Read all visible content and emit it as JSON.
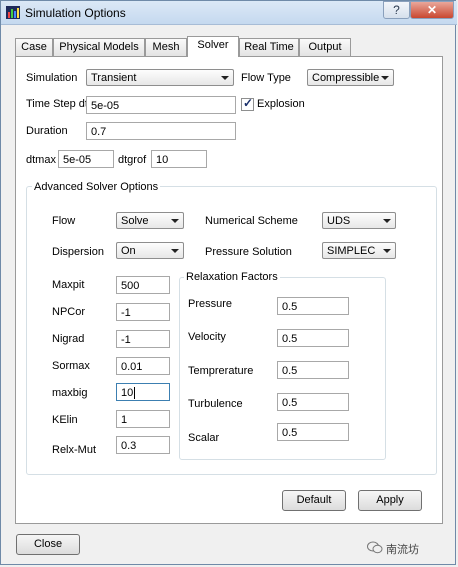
{
  "window": {
    "title": "Simulation Options",
    "help": "?",
    "close": "✕"
  },
  "tabs": [
    {
      "label": "Case",
      "active": false
    },
    {
      "label": "Physical Models",
      "active": false
    },
    {
      "label": "Mesh",
      "active": false
    },
    {
      "label": "Solver",
      "active": true
    },
    {
      "label": "Real Time",
      "active": false
    },
    {
      "label": "Output",
      "active": false
    }
  ],
  "solver": {
    "simulation_label": "Simulation",
    "simulation_value": "Transient",
    "flow_type_label": "Flow Type",
    "flow_type_value": "Compressible",
    "time_step_label": "Time Step dt",
    "time_step_value": "5e-05",
    "explosion_label": "Explosion",
    "explosion_checked": true,
    "duration_label": "Duration",
    "duration_value": "0.7",
    "dtmax_label": "dtmax",
    "dtmax_value": "5e-05",
    "dtgrof_label": "dtgrof",
    "dtgrof_value": "10"
  },
  "advanced": {
    "title": "Advanced Solver Options",
    "flow_label": "Flow",
    "flow_value": "Solve",
    "dispersion_label": "Dispersion",
    "dispersion_value": "On",
    "scheme_label": "Numerical Scheme",
    "scheme_value": "UDS",
    "pressure_solution_label": "Pressure Solution",
    "pressure_solution_value": "SIMPLEC",
    "maxpit_label": "Maxpit",
    "maxpit_value": "500",
    "npcor_label": "NPCor",
    "npcor_value": "-1",
    "nigrad_label": "Nigrad",
    "nigrad_value": "-1",
    "sormax_label": "Sormax",
    "sormax_value": "0.01",
    "maxbig_label": "maxbig",
    "maxbig_value": "10",
    "kelin_label": "KElin",
    "kelin_value": "1",
    "relxmut_label": "Relx-Mut",
    "relxmut_value": "0.3"
  },
  "relaxation": {
    "title": "Relaxation Factors",
    "pressure_label": "Pressure",
    "pressure_value": "0.5",
    "velocity_label": "Velocity",
    "velocity_value": "0.5",
    "temperature_label": "Tempreraturе",
    "temperature_value": "0.5",
    "turbulence_label": "Turbulence",
    "turbulence_value": "0.5",
    "scalar_label": "Scalar",
    "scalar_value": "0.5"
  },
  "buttons": {
    "default": "Default",
    "apply": "Apply",
    "close": "Close"
  },
  "watermark": "南流坊"
}
